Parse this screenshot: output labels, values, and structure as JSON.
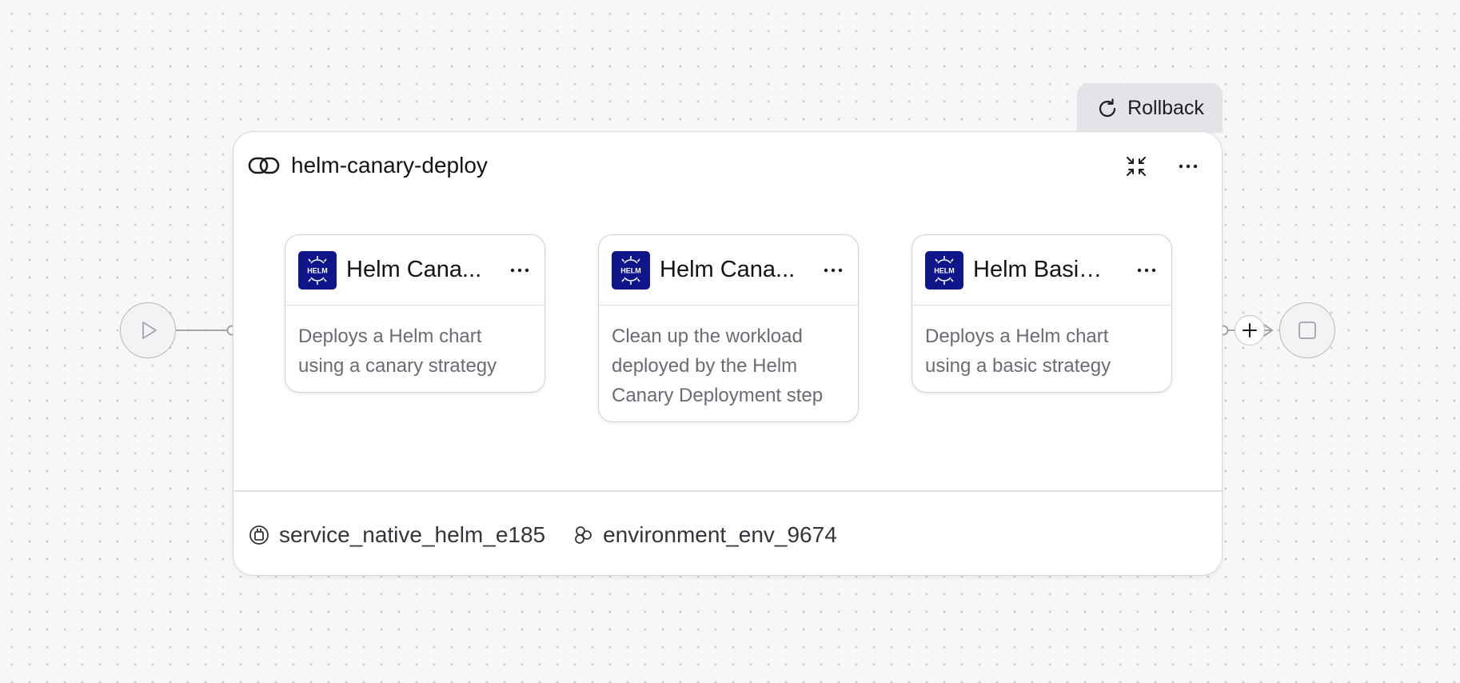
{
  "rollback": {
    "label": "Rollback"
  },
  "stage": {
    "title": "helm-canary-deploy",
    "service": "service_native_helm_e185",
    "environment": "environment_env_9674"
  },
  "steps": [
    {
      "logo_text": "HELM",
      "title": "Helm Cana...",
      "description": "Deploys a Helm chart using a canary strategy"
    },
    {
      "logo_text": "HELM",
      "title": "Helm Cana...",
      "description": "Clean up the workload deployed by the Helm Canary Deployment step"
    },
    {
      "logo_text": "HELM",
      "title": "Helm Basic...",
      "description": "Deploys a Helm chart using a basic strategy"
    }
  ],
  "colors": {
    "helm_badge": "#0f1689",
    "canvas_bg": "#f7f7f8",
    "card_border": "#cfcfd4",
    "connector": "#9a9aa1"
  },
  "icons": {
    "rollback": "refresh-icon",
    "stage": "link-icon",
    "collapse": "collapse-icon",
    "more": "more-horizontal-icon",
    "start": "play-icon",
    "end": "stop-icon",
    "add": "plus-icon",
    "service": "service-icon",
    "environment": "environment-icon"
  }
}
